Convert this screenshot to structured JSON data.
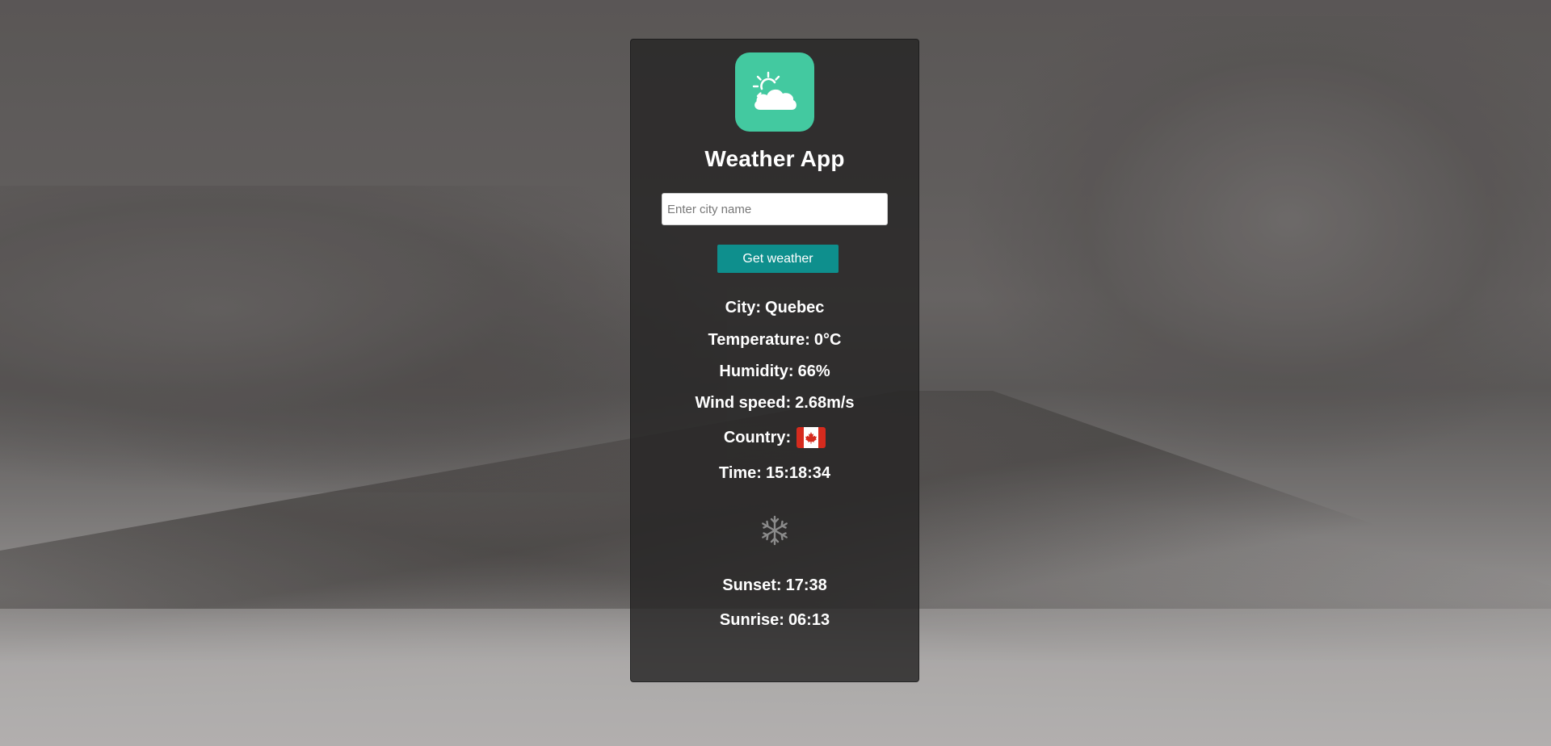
{
  "app": {
    "title": "Weather App",
    "icon": "partly-cloudy-icon",
    "accent_color": "#43c9a0"
  },
  "search": {
    "placeholder": "Enter city name",
    "value": "",
    "button_label": "Get weather",
    "button_color": "#0e8f8d"
  },
  "weather": {
    "city_label": "City:",
    "city": "Quebec",
    "temperature_label": "Temperature:",
    "temperature": "0°C",
    "humidity_label": "Humidity:",
    "humidity": "66%",
    "wind_label": "Wind speed:",
    "wind": "2.68m/s",
    "country_label": "Country:",
    "country_flag": "canada-flag-icon",
    "time_label": "Time:",
    "time": "15:18:34",
    "condition_icon": "snowflake-icon",
    "sunset_label": "Sunset:",
    "sunset": "17:38",
    "sunrise_label": "Sunrise:",
    "sunrise": "06:13"
  }
}
